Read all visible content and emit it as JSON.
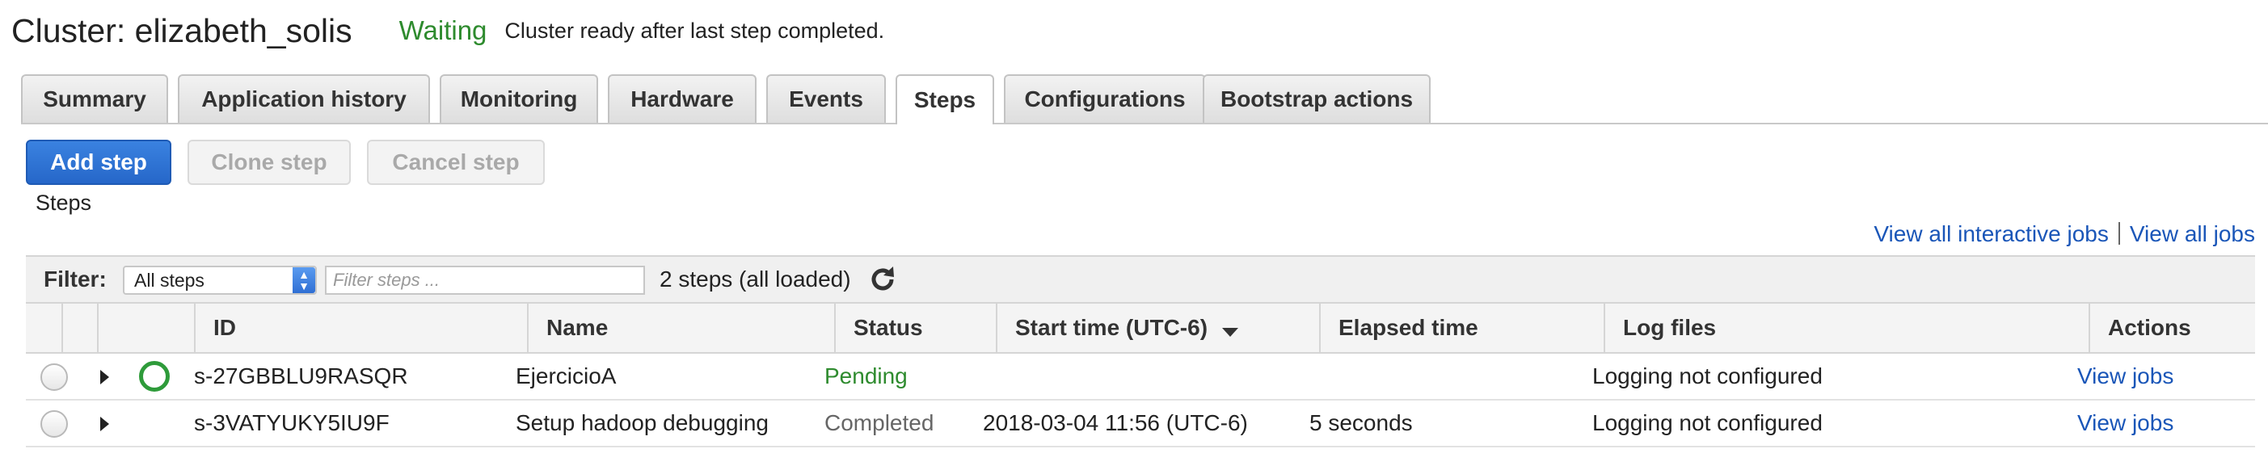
{
  "header": {
    "cluster_title": "Cluster: elizabeth_solis",
    "cluster_status": "Waiting",
    "status_message": "Cluster ready after last step completed."
  },
  "tabs": [
    {
      "label": "Summary",
      "active": false
    },
    {
      "label": "Application history",
      "active": false
    },
    {
      "label": "Monitoring",
      "active": false
    },
    {
      "label": "Hardware",
      "active": false
    },
    {
      "label": "Events",
      "active": false
    },
    {
      "label": "Steps",
      "active": true
    },
    {
      "label": "Configurations",
      "active": false
    },
    {
      "label": "Bootstrap actions",
      "active": false
    }
  ],
  "toolbar": {
    "add_step": "Add step",
    "clone_step": "Clone step",
    "cancel_step": "Cancel step"
  },
  "section_label": "Steps",
  "links": {
    "interactive_jobs": "View all interactive jobs",
    "all_jobs": "View all jobs"
  },
  "filter": {
    "label": "Filter:",
    "select_value": "All steps",
    "input_placeholder": "Filter steps ...",
    "count_text": "2 steps (all loaded)"
  },
  "table": {
    "columns": {
      "id": "ID",
      "name": "Name",
      "status": "Status",
      "start_time": "Start time (UTC-6)",
      "elapsed": "Elapsed time",
      "log_files": "Log files",
      "actions": "Actions"
    },
    "rows": [
      {
        "id": "s-27GBBLU9RASQR",
        "name": "EjercicioA",
        "status": "Pending",
        "start_time": "",
        "elapsed": "",
        "log_files": "Logging not configured",
        "action": "View jobs"
      },
      {
        "id": "s-3VATYUKY5IU9F",
        "name": "Setup hadoop debugging",
        "status": "Completed",
        "start_time": "2018-03-04 11:56 (UTC-6)",
        "elapsed": "5 seconds",
        "log_files": "Logging not configured",
        "action": "View jobs"
      }
    ]
  },
  "colors": {
    "primary_button": "#2667c9",
    "status_waiting": "#2e8b2e",
    "link": "#1a56b8"
  }
}
